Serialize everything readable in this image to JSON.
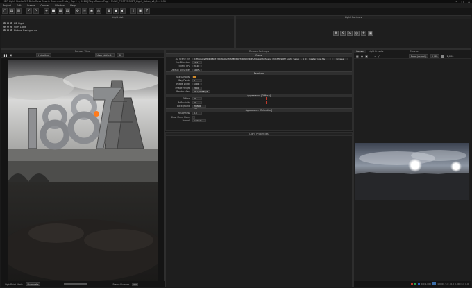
{
  "app": {
    "title": "HDR Light Studio 5.3 Beta Ross Cowrie Business Friday, April 1, 2016 [PlayaMaletaPag] - RUNE_POSTERSKET_Light_Setup_v1_01.HLS5",
    "window_controls": [
      "–",
      "□",
      "×"
    ]
  },
  "menu": [
    "Project",
    "Edit",
    "Create",
    "Canvas",
    "Window",
    "Help"
  ],
  "toolbar": {
    "buttons": [
      {
        "name": "new-project",
        "glyph": "▢"
      },
      {
        "name": "open-project",
        "glyph": "▤"
      },
      {
        "name": "save-project",
        "glyph": "▥"
      },
      {
        "name": "undo",
        "glyph": "↶"
      },
      {
        "name": "redo",
        "glyph": "↷"
      },
      {
        "name": "new-light",
        "glyph": "+"
      },
      {
        "name": "area-light",
        "glyph": "■"
      },
      {
        "name": "light-preset",
        "glyph": "▦"
      },
      {
        "name": "gradient",
        "glyph": "▤"
      },
      {
        "name": "settings",
        "glyph": "⚙"
      },
      {
        "name": "sun-light",
        "glyph": "☼"
      },
      {
        "name": "render",
        "glyph": "◉"
      },
      {
        "name": "camera",
        "glyph": "◎"
      },
      {
        "name": "grid-view",
        "glyph": "▦"
      },
      {
        "name": "sphere-view",
        "glyph": "●"
      },
      {
        "name": "env-view",
        "glyph": "◐"
      },
      {
        "name": "export",
        "glyph": "⇪"
      },
      {
        "name": "screenshot",
        "glyph": "▣"
      },
      {
        "name": "help",
        "glyph": "?"
      }
    ]
  },
  "light_list": {
    "title": "Light List",
    "items": [
      "HR Light",
      "Slim Light",
      "Picture Background"
    ]
  },
  "light_controls": {
    "title": "Light Controls",
    "buttons": [
      {
        "name": "move",
        "glyph": "✥"
      },
      {
        "name": "rotate",
        "glyph": "⟲"
      },
      {
        "name": "scale",
        "glyph": "⇲"
      },
      {
        "name": "light-target",
        "glyph": "◎"
      },
      {
        "name": "light-add",
        "glyph": "✚"
      },
      {
        "name": "light-copy",
        "glyph": "▣"
      }
    ]
  },
  "render_view": {
    "title": "Render View",
    "mode": "Unlimited",
    "view": "View (default)",
    "zoom": "Fit",
    "status_left": "LightPaint Mode",
    "status_mode": "Illuminate",
    "frame_label": "Frame Number",
    "frame_value": "0.0"
  },
  "render_settings": {
    "title": "Render Settings",
    "sections": {
      "scene": "Scene",
      "renderer": "Renderer",
      "diffuse": "Appearance [Diffuse]",
      "reflection": "Appearance [Reflection]"
    },
    "scene_file_label": "3D Scene File",
    "scene_file_value": "D:/Projects/HDR/1887_3D/PARIS/POSTERSKET/RENDER/PLAYA/Lights/Scene_POSTERSKET_Light_Setup_1_5_01_master_new.hls",
    "browse": "Browse",
    "up_direction_label": "Up Direction",
    "up_direction_value": "POS",
    "scene_fps_label": "Scene FPS",
    "scene_fps_value": "24.0",
    "default_dk_scaler_label": "Default Dk Scaler",
    "default_dk_scaler_value": "100%",
    "max_samples_label": "Max Samples",
    "max_samples_value": "",
    "ray_depth_label": "Ray Depth",
    "ray_depth_value": "4",
    "image_width_label": "Image Width",
    "image_width_value": "1700",
    "image_height_label": "Image Height",
    "image_height_value": "2100",
    "render_view_label": "Render View",
    "render_view_value": "DEA/HOTEL(F)",
    "diffuse_label": "Diffuse",
    "diffuse_value": "90",
    "reflectivity_label": "Reflectivity",
    "reflectivity_value": "90",
    "background_label": "Background",
    "background_value": "HBBHII Pro",
    "roughness_label": "Roughness",
    "roughness_value": "0.0",
    "show_plane_label": "Show Plane Plane",
    "fresnel_label": "Fresnel",
    "fresnel_value": "Custom"
  },
  "light_properties": {
    "title": "Light Properties"
  },
  "canvas_panel": {
    "tabs": [
      "Canvas",
      "Light Presets"
    ],
    "title": "Canvas",
    "view": "Base (default)",
    "format": "HDR",
    "width": "1,000",
    "coords": "1.000  ·  S:0 · 0.0  0.000 0.0  0.0",
    "status_text": "0.0  1.000"
  }
}
